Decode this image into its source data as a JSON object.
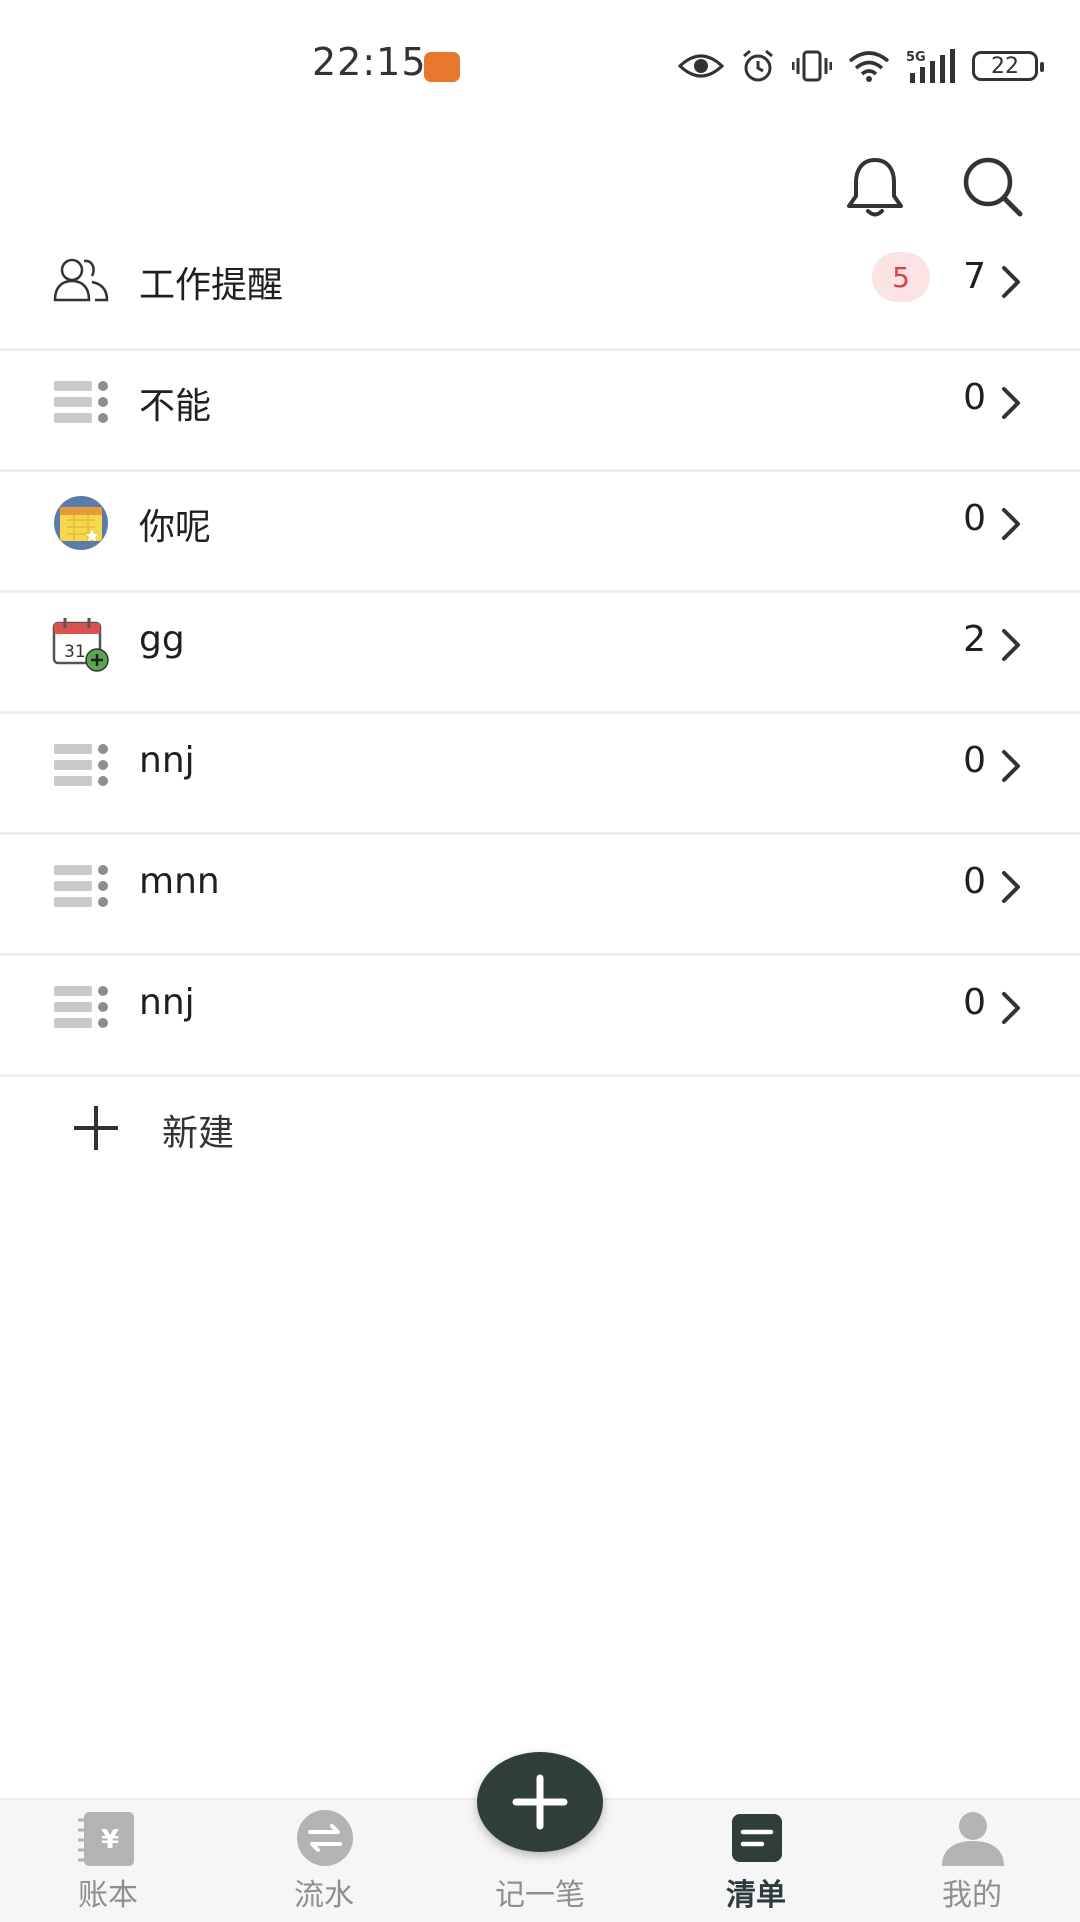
{
  "status_bar": {
    "time": "22:15",
    "battery": "22"
  },
  "lists": [
    {
      "name": "工作提醒",
      "badge": "5",
      "count": "7",
      "icon": "people-icon"
    },
    {
      "name": "不能",
      "count": "0",
      "icon": "list-icon"
    },
    {
      "name": "你呢",
      "count": "0",
      "icon": "calendar-star-icon"
    },
    {
      "name": "gg",
      "count": "2",
      "icon": "calendar-add-icon"
    },
    {
      "name": "nnj",
      "count": "0",
      "icon": "list-icon"
    },
    {
      "name": "mnn",
      "count": "0",
      "icon": "list-icon"
    },
    {
      "name": "nnj",
      "count": "0",
      "icon": "list-icon"
    }
  ],
  "new_list_label": "新建",
  "nav": [
    {
      "label": "账本",
      "icon": "ledger-icon"
    },
    {
      "label": "流水",
      "icon": "exchange-icon"
    },
    {
      "label": "记一笔",
      "icon": "plus-icon"
    },
    {
      "label": "清单",
      "icon": "list-doc-icon",
      "active": true
    },
    {
      "label": "我的",
      "icon": "person-icon"
    }
  ],
  "colors": {
    "accent": "#2f3d3b",
    "badge_bg": "#fbe3e4",
    "badge_text": "#d9414a",
    "nav_bg": "#f6f6f8"
  }
}
